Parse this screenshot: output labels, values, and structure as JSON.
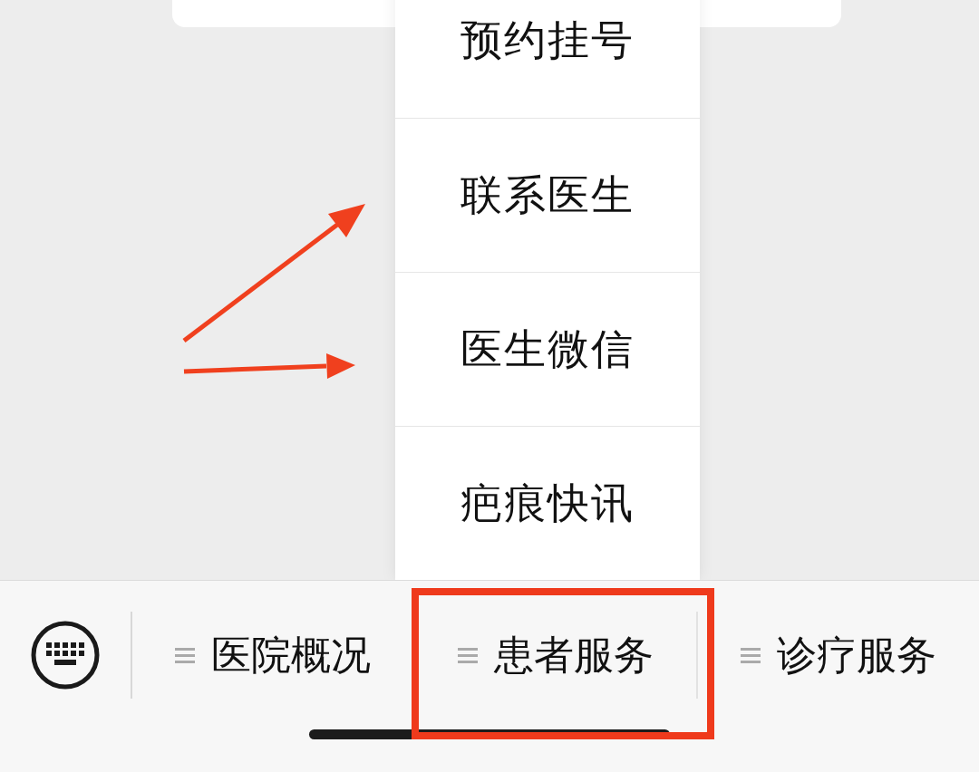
{
  "menu": {
    "items": [
      {
        "label": "预约挂号"
      },
      {
        "label": "联系医生"
      },
      {
        "label": "医生微信"
      },
      {
        "label": "疤痕快讯"
      }
    ]
  },
  "bottom_bar": {
    "tabs": [
      {
        "label": "医院概况",
        "highlighted": false
      },
      {
        "label": "患者服务",
        "highlighted": true
      },
      {
        "label": "诊疗服务",
        "highlighted": false
      }
    ]
  }
}
